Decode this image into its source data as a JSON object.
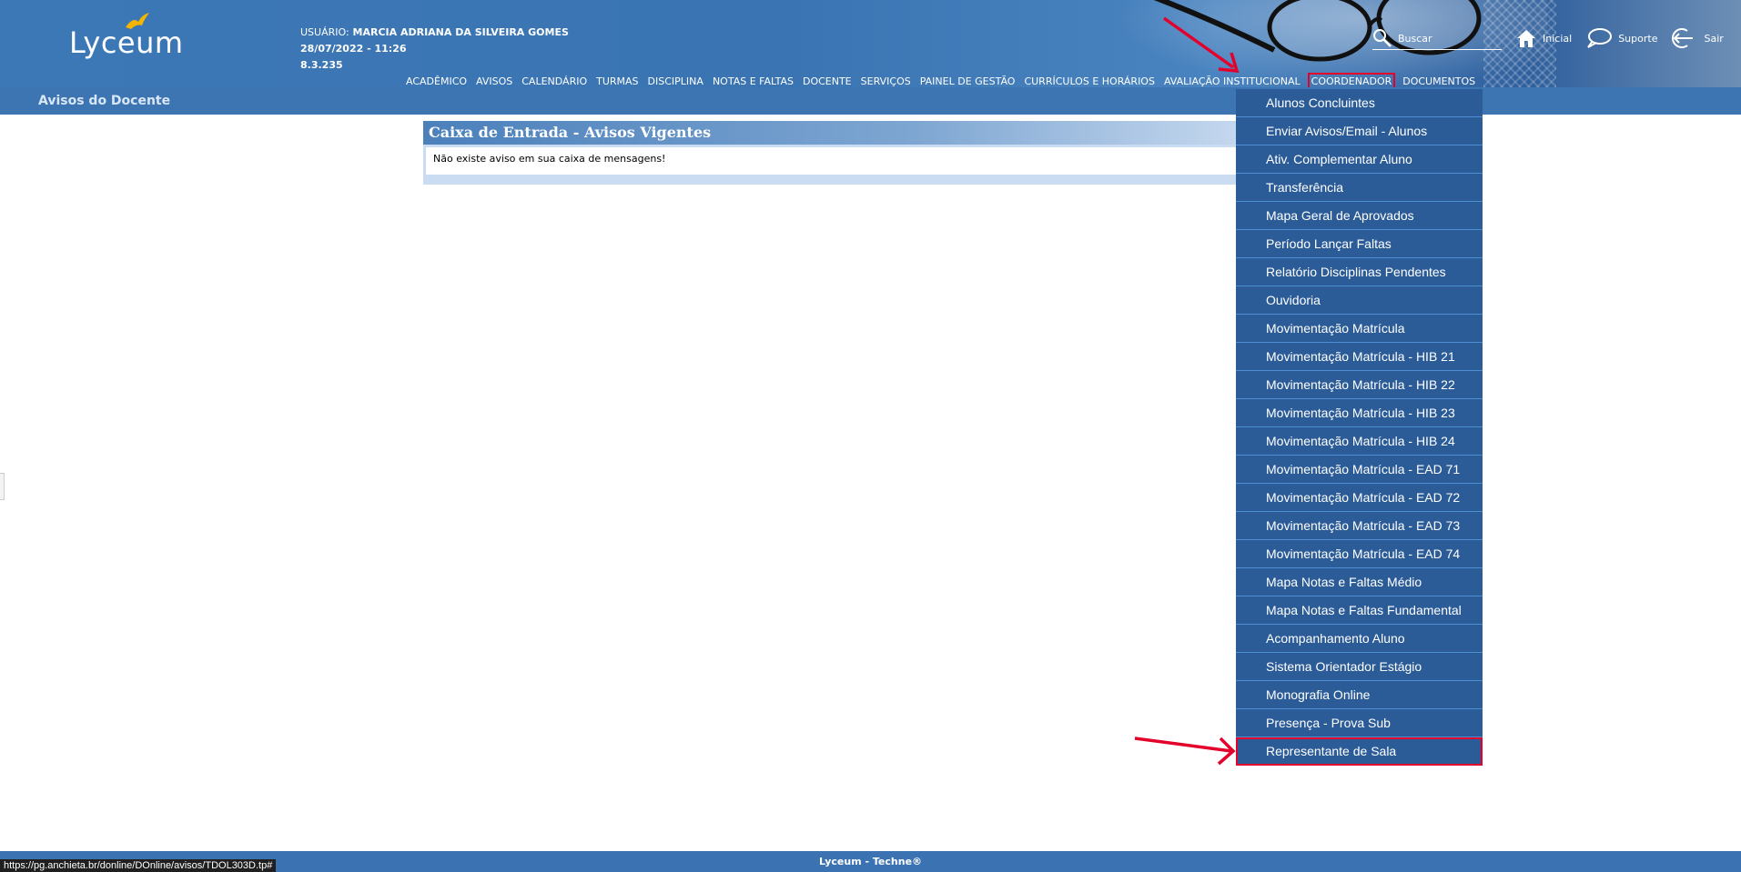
{
  "app": {
    "logo_text": "Lyceum"
  },
  "user": {
    "label": "USUÁRIO:",
    "name": "MARCIA ADRIANA DA SILVEIRA GOMES",
    "datetime": "28/07/2022 - 11:26",
    "version": "8.3.235"
  },
  "search": {
    "placeholder": "Buscar"
  },
  "top_links": [
    {
      "label": "Inicial",
      "icon": "home-icon"
    },
    {
      "label": "Suporte",
      "icon": "speech-bubble-icon"
    },
    {
      "label": "Sair",
      "icon": "logout-icon"
    }
  ],
  "nav": {
    "items": [
      "ACADÊMICO",
      "AVISOS",
      "CALENDÁRIO",
      "TURMAS",
      "DISCIPLINA",
      "NOTAS E FALTAS",
      "DOCENTE",
      "SERVIÇOS",
      "PAINEL DE GESTÃO",
      "CURRÍCULOS E HORÁRIOS",
      "AVALIAÇÃO INSTITUCIONAL",
      "COORDENADOR",
      "DOCUMENTOS"
    ],
    "active": "COORDENADOR"
  },
  "subbar": {
    "title": "Avisos do Docente"
  },
  "inbox": {
    "title": "Caixa de Entrada - Avisos Vigentes",
    "message": "Não existe aviso em sua caixa de mensagens!"
  },
  "dropdown": {
    "items": [
      "Alunos Concluintes",
      "Enviar Avisos/Email - Alunos",
      "Ativ. Complementar Aluno",
      "Transferência",
      "Mapa Geral de Aprovados",
      "Período Lançar Faltas",
      "Relatório Disciplinas Pendentes",
      "Ouvidoria",
      "Movimentação Matrícula",
      "Movimentação Matrícula - HIB 21",
      "Movimentação Matrícula - HIB 22",
      "Movimentação Matrícula - HIB 23",
      "Movimentação Matrícula - HIB 24",
      "Movimentação Matrícula - EAD 71",
      "Movimentação Matrícula - EAD 72",
      "Movimentação Matrícula - EAD 73",
      "Movimentação Matrícula - EAD 74",
      "Mapa Notas e Faltas Médio",
      "Mapa Notas e Faltas Fundamental",
      "Acompanhamento Aluno",
      "Sistema Orientador Estágio",
      "Monografia Online",
      "Presença - Prova Sub",
      "Representante de Sala"
    ],
    "highlighted": "Representante de Sala"
  },
  "footer": {
    "text": "Lyceum - Techne®"
  },
  "status_bar": {
    "url": "https://pg.anchieta.br/donline/DOnline/avisos/TDOL303D.tp#"
  },
  "colors": {
    "header_blue": "#3d78b6",
    "menu_blue": "#2b5c97",
    "highlight_red": "#e3002b"
  }
}
